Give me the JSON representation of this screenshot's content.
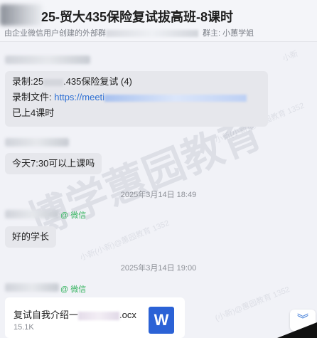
{
  "header": {
    "title": "25-贸大435保险复试拔高班-8课时",
    "subtitle": "由企业微信用户创建的外部群",
    "owner": "群主: 小蕙学姐"
  },
  "messages": {
    "m1": {
      "line1_prefix": "录制:25",
      "line1_suffix": ".435保险复试 (4)",
      "line2_label": "录制文件: ",
      "line2_link": "https://meeti",
      "line3": "已上4课时"
    },
    "m2": {
      "text": "今天7:30可以上课吗"
    },
    "ts1": "2025年3月14日 18:49",
    "sender1_tag": "@ 微信",
    "m3": {
      "text": "好的学长"
    },
    "ts2": "2025年3月14日 19:00",
    "sender2_tag": "@ 微信",
    "file": {
      "name_prefix": "复试自我介绍一",
      "name_suffix": ".ocx",
      "size": "15.1K",
      "icon_letter": "W"
    }
  },
  "watermark": {
    "big": "博学蕙园教育",
    "small1": "小新",
    "small2": "小新(小新)@蕙园教育 1352",
    "small3": "小新(小新)@蕙园教育 1352",
    "small4": "(小新)@蕙园教育 1352"
  },
  "ui": {
    "scroll_icon": "double-chevron-down-icon"
  }
}
